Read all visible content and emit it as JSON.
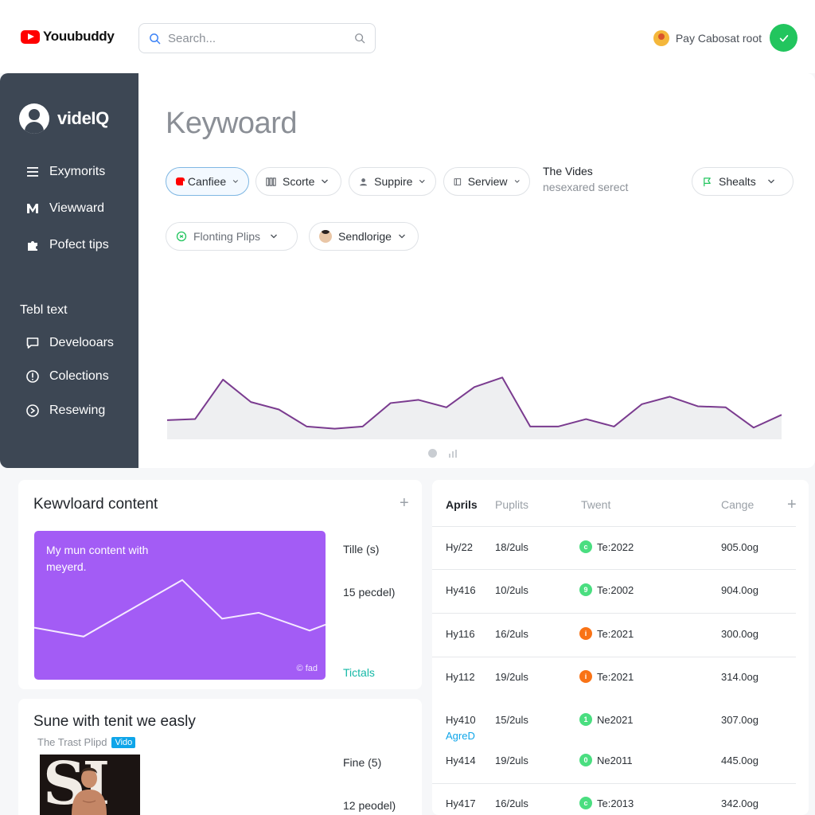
{
  "header": {
    "logo_text": "Youubuddy",
    "search": {
      "placeholder": "Search..."
    },
    "user": {
      "name": "Pay Cabosat root"
    }
  },
  "sidebar": {
    "brand": "videIQ",
    "items": [
      {
        "label": "Exymorits",
        "icon": "menu-icon"
      },
      {
        "label": "Viewward",
        "icon": "m-logo-icon"
      },
      {
        "label": "Pofect tips",
        "icon": "puzzle-icon"
      }
    ],
    "section_heading": "Tebl text",
    "section_items": [
      {
        "label": "Develooars",
        "icon": "chat-icon"
      },
      {
        "label": "Colections",
        "icon": "info-icon"
      },
      {
        "label": "Resewing",
        "icon": "settings-icon"
      }
    ]
  },
  "main": {
    "title": "Keywoard",
    "filters": [
      {
        "label": "Canfiee",
        "icon": "youtube-icon",
        "active": true
      },
      {
        "label": "Scorte",
        "icon": "bars-icon"
      },
      {
        "label": "Suppire",
        "icon": "person-icon"
      },
      {
        "label": "Serview",
        "icon": "panel-icon"
      },
      {
        "label": "Shealts",
        "icon": "flag-icon"
      },
      {
        "label": "Flonting Plips",
        "icon": "refresh-icon"
      },
      {
        "label": "Sendlorige",
        "icon": "avatar-icon"
      }
    ],
    "info": {
      "title": "The Vides",
      "subtitle": "nesexared serect"
    },
    "trend_chart": {
      "values": [
        18,
        19,
        56,
        35,
        28,
        12,
        10,
        12,
        34,
        37,
        30,
        49,
        58,
        12,
        12,
        19,
        12,
        33,
        40,
        31,
        30,
        11,
        23
      ],
      "ylim": [
        0,
        100
      ],
      "line_color": "#7a3b8f",
      "fill_color": "#eeeff1"
    }
  },
  "content_card": {
    "title": "Kewvloard content",
    "panel_text": "My mun content with meyerd.",
    "panel_tag": "© fad",
    "panel_chart": {
      "values": [
        35,
        29,
        48,
        67,
        41,
        45,
        33,
        37
      ],
      "ylim": [
        0,
        100
      ]
    },
    "stats": [
      "Tille (s)",
      "15 pecdel)"
    ],
    "link": "Tictals"
  },
  "video_card": {
    "title": "Sune with tenit we easly",
    "subtitle": "The Trast Plipd",
    "badge": "Vido",
    "thumbnail_text": "SI",
    "stats": [
      "Fine (5)",
      "12 peodel)"
    ]
  },
  "table": {
    "headers": [
      "Aprils",
      "Puplits",
      "Twent",
      "Cange"
    ],
    "rows": [
      {
        "a": "Hy/22",
        "b": "18/2uls",
        "tag": "Te:2022",
        "tag_color": "#4ade80",
        "tag_glyph": "c",
        "d": "905.0og"
      },
      {
        "a": "Hy416",
        "b": "10/2uls",
        "tag": "Te:2002",
        "tag_color": "#4ade80",
        "tag_glyph": "9",
        "d": "904.0og"
      },
      {
        "a": "Hy116",
        "b": "16/2uls",
        "tag": "Te:2021",
        "tag_color": "#f97316",
        "tag_glyph": "i",
        "d": "300.0og"
      },
      {
        "a": "Hy112",
        "b": "19/2uls",
        "tag": "Te:2021",
        "tag_color": "#f97316",
        "tag_glyph": "i",
        "d": "314.0og"
      },
      {
        "a": "Hy410",
        "b": "15/2uls",
        "tag": "Ne2021",
        "tag_color": "#4ade80",
        "tag_glyph": "1",
        "d": "307.0og",
        "sub": "AgreD"
      },
      {
        "a": "Hy414",
        "b": "19/2uls",
        "tag": "Ne2011",
        "tag_color": "#4ade80",
        "tag_glyph": "0",
        "d": "445.0og"
      },
      {
        "a": "Hy417",
        "b": "16/2uls",
        "tag": "Te:2013",
        "tag_color": "#4ade80",
        "tag_glyph": "c",
        "d": "342.0og"
      }
    ]
  },
  "colors": {
    "sidebar": "#3d4754",
    "accent_purple": "#a35cf5",
    "success": "#22c55e",
    "link_teal": "#14b8a6"
  }
}
